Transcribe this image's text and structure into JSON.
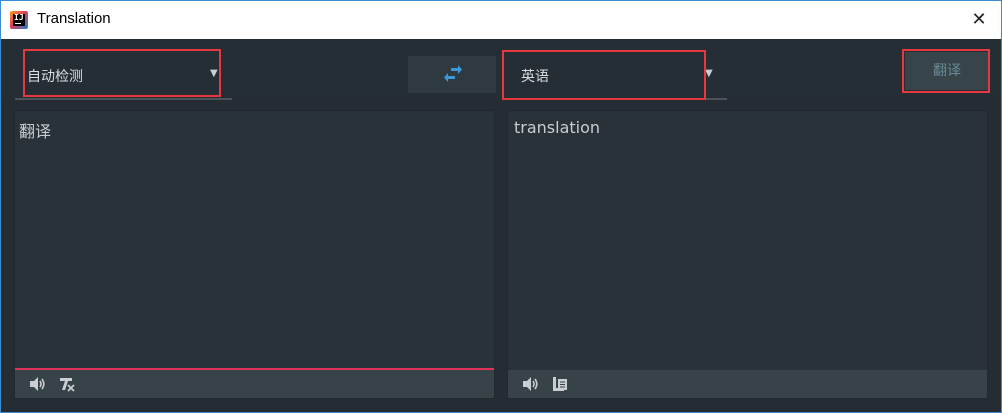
{
  "window": {
    "title": "Translation",
    "close_glyph": "✕"
  },
  "toolbar": {
    "source_language": "自动检测",
    "target_language": "英语",
    "translate_label": "翻译",
    "swap_icon": "swap-arrows-icon"
  },
  "source_panel": {
    "text": "翻译",
    "icons": [
      "speaker-icon",
      "clear-text-icon"
    ]
  },
  "target_panel": {
    "text": "translation",
    "icons": [
      "speaker-icon",
      "copy-icon"
    ]
  },
  "colors": {
    "accent_red": "#e8383f",
    "focus_line": "#e0335a",
    "swap_blue": "#3a9ad9",
    "panel_bg": "#293239"
  }
}
